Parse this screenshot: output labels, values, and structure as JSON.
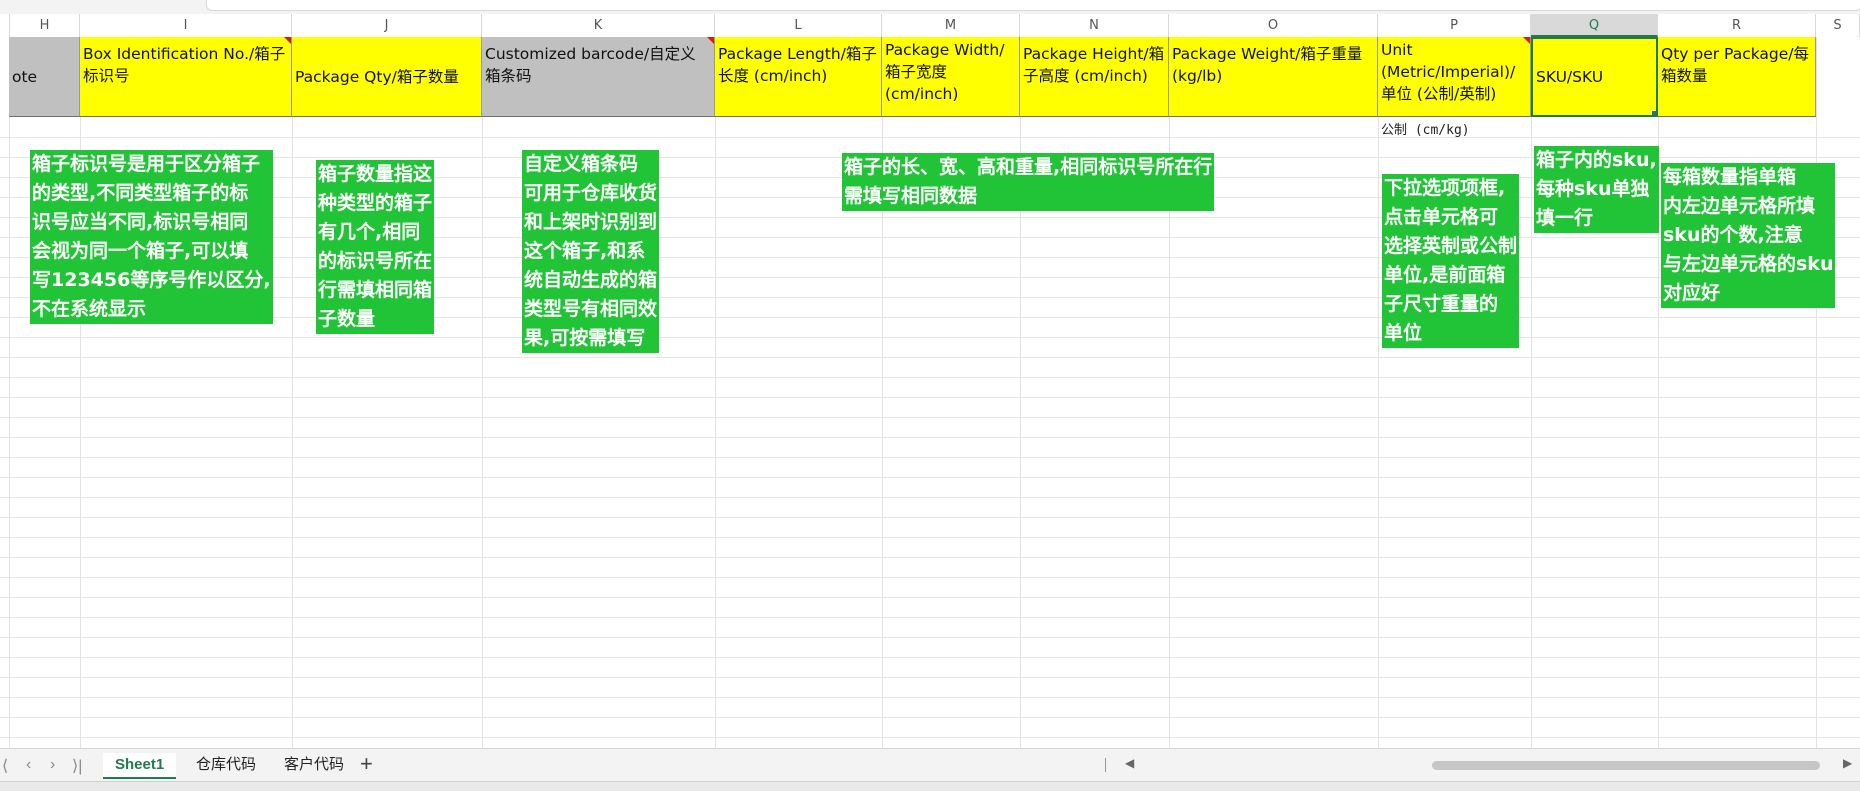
{
  "columns": [
    "H",
    "I",
    "J",
    "K",
    "L",
    "M",
    "N",
    "O",
    "P",
    "Q",
    "R",
    "S"
  ],
  "selected_column": "Q",
  "headers": {
    "H": "ote",
    "I": "Box Identification No./箱子标识号",
    "J": "Package Qty/箱子数量",
    "K": "Customized barcode/自定义箱条码",
    "L": "Package Length/箱子长度 (cm/inch)",
    "M": "Package Width/箱子宽度 (cm/inch)",
    "N": "Package Height/箱子高度 (cm/inch)",
    "O": "Package Weight/箱子重量 (kg/lb)",
    "P": "Unit (Metric/Imperial)/单位 (公制/英制)",
    "Q": "SKU/SKU",
    "R": "Qty per Package/每箱数量"
  },
  "unit_value": "公制 (cm/kg)",
  "notes": {
    "box_id": "箱子标识号是用于区分箱子\n的类型,不同类型箱子的标\n识号应当不同,标识号相同\n会视为同一个箱子,可以填\n写123456等序号作以区分,\n不在系统显示",
    "qty": "箱子数量指这\n种类型的箱子\n有几个,相同\n的标识号所在\n行需填相同箱\n子数量",
    "barcode": "自定义箱条码\n可用于仓库收货\n和上架时识别到\n这个箱子,和系\n统自动生成的箱\n类型号有相同效\n果,可按需填写",
    "dimensions": "箱子的长、宽、高和重量,相同标识号所在行\n需填写相同数据",
    "unit": "下拉选项项框,\n点击单元格可\n选择英制或公制\n单位,是前面箱\n子尺寸重量的\n单位",
    "sku": "箱子内的sku,\n每种sku单独\n填一行",
    "qty_per_package": "每箱数量指单箱\n内左边单元格所填\nsku的个数,注意\n与左边单元格的sku\n对应好"
  },
  "sheet_tabs": [
    "Sheet1",
    "仓库代码",
    "客户代码"
  ],
  "active_sheet": "Sheet1",
  "nav": {
    "first": "⟨",
    "prev": "‹",
    "next": "›",
    "last": "⟩|",
    "add": "+"
  },
  "colors": {
    "header_yellow": "#ffff00",
    "header_gray": "#c0c0c0",
    "note_green": "#22c437",
    "accent": "#1f7a4d"
  }
}
